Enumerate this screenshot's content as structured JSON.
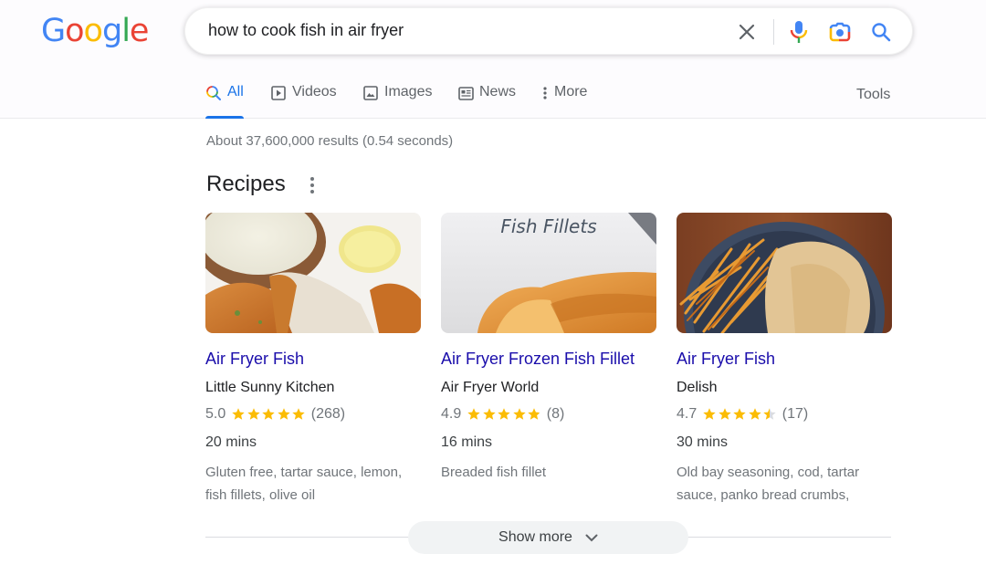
{
  "brand": {
    "logo_letters": [
      {
        "char": "G",
        "color": "#4285f4"
      },
      {
        "char": "o",
        "color": "#ea4335"
      },
      {
        "char": "o",
        "color": "#fbbc05"
      },
      {
        "char": "g",
        "color": "#4285f4"
      },
      {
        "char": "l",
        "color": "#34a853"
      },
      {
        "char": "e",
        "color": "#ea4335"
      }
    ]
  },
  "search": {
    "query": "how to cook fish in air fryer",
    "icons": [
      "clear-icon",
      "voice-search-icon",
      "image-search-icon",
      "search-icon"
    ]
  },
  "tabs": [
    {
      "label": "All",
      "icon": "search-icon",
      "active": true
    },
    {
      "label": "Videos",
      "icon": "video-icon",
      "active": false
    },
    {
      "label": "Images",
      "icon": "image-icon",
      "active": false
    },
    {
      "label": "News",
      "icon": "news-icon",
      "active": false
    },
    {
      "label": "More",
      "icon": "more-vert-icon",
      "active": false
    }
  ],
  "tools_label": "Tools",
  "result_stats": "About 37,600,000 results (0.54 seconds)",
  "recipes": {
    "title": "Recipes",
    "cards": [
      {
        "title": "Air Fryer Fish",
        "source": "Little Sunny Kitchen",
        "rating": "5.0",
        "rating_value": 5.0,
        "reviews": "(268)",
        "time": "20 mins",
        "ingredients": "Gluten free, tartar sauce, lemon, fish fillets, olive oil",
        "image_alt": "Breaded fish fillets with tartar sauce and lemon"
      },
      {
        "title": "Air Fryer Frozen Fish Fillet",
        "source": "Air Fryer World",
        "rating": "4.9",
        "rating_value": 4.9,
        "reviews": "(8)",
        "time": "16 mins",
        "ingredients": "Breaded fish fillet",
        "image_caption": "Fish Fillets",
        "image_alt": "Golden breaded fish fillets"
      },
      {
        "title": "Air Fryer Fish",
        "source": "Delish",
        "rating": "4.7",
        "rating_value": 4.5,
        "reviews": "(17)",
        "time": "30 mins",
        "ingredients": "Old bay seasoning, cod, tartar sauce, panko bread crumbs,",
        "image_alt": "Fish fillets with fries on a blue plate"
      }
    ],
    "show_more_label": "Show more"
  },
  "colors": {
    "accent": "#1a73e8",
    "link": "#1a0dab",
    "star": "#fbbc04",
    "star_empty": "#dadce0"
  }
}
